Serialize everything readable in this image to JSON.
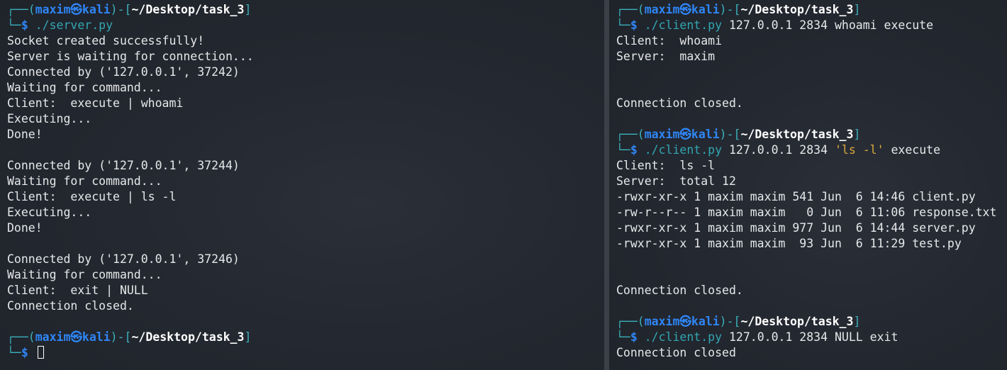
{
  "prompt": {
    "user": "maxim",
    "host": "kali",
    "skull": "㉿",
    "path": "~/Desktop/task_3",
    "dollar": "$"
  },
  "left": {
    "cmd1": "./server.py",
    "out1": [
      "Socket created successfully!",
      "Server is waiting for connection...",
      "Connected by ('127.0.0.1', 37242)",
      "Waiting for command...",
      "Client:  execute | whoami",
      "Executing...",
      "Done!",
      "",
      "Connected by ('127.0.0.1', 37244)",
      "Waiting for command...",
      "Client:  execute | ls -l",
      "Executing...",
      "Done!",
      "",
      "Connected by ('127.0.0.1', 37246)",
      "Waiting for command...",
      "Client:  exit | NULL",
      "Connection closed.",
      ""
    ]
  },
  "right": {
    "cmd1": {
      "prog": "./client.py",
      "args": " 127.0.0.1 2834 whoami execute"
    },
    "out1": [
      "Client:  whoami",
      "Server:  maxim",
      "",
      "",
      "Connection closed.",
      ""
    ],
    "cmd2": {
      "prog": "./client.py",
      "args_a": " 127.0.0.1 2834 ",
      "quoted": "'ls -l'",
      "args_b": " execute"
    },
    "out2": [
      "Client:  ls -l",
      "Server:  total 12",
      "-rwxr-xr-x 1 maxim maxim 541 Jun  6 14:46 client.py",
      "-rw-r--r-- 1 maxim maxim   0 Jun  6 11:06 response.txt",
      "-rwxr-xr-x 1 maxim maxim 977 Jun  6 14:44 server.py",
      "-rwxr-xr-x 1 maxim maxim  93 Jun  6 11:29 test.py",
      "",
      "",
      "Connection closed.",
      ""
    ],
    "cmd3": {
      "prog": "./client.py",
      "args": " 127.0.0.1 2834 NULL exit"
    },
    "out3": [
      "Connection closed"
    ]
  }
}
